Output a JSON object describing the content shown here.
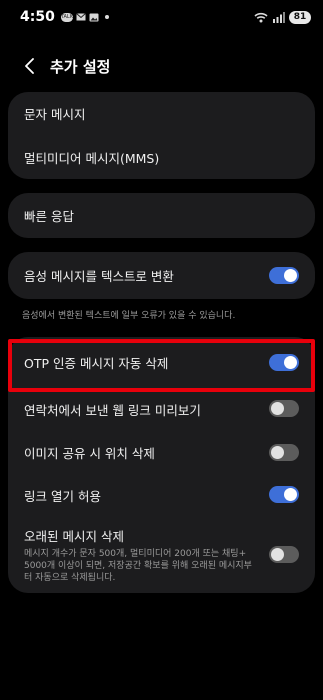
{
  "status_bar": {
    "time": "4:50",
    "icons": [
      "chat-icon",
      "mail-icon",
      "image-icon",
      "dot-icon",
      "wifi-icon",
      "signal-icon"
    ],
    "battery": "81"
  },
  "header": {
    "back_icon": "chevron-left-icon",
    "title": "추가 설정"
  },
  "group1": {
    "items": [
      {
        "label": "문자 메시지"
      },
      {
        "label": "멀티미디어 메시지(MMS)"
      }
    ]
  },
  "group2": {
    "items": [
      {
        "label": "빠른 응답"
      }
    ]
  },
  "group3": {
    "label": "음성 메시지를 텍스트로 변환",
    "enabled": true,
    "helper": "음성에서 변환된 텍스트에 일부 오류가 있을 수 있습니다."
  },
  "group4": {
    "items": [
      {
        "label": "OTP 인증 메시지 자동 삭제",
        "enabled": true
      },
      {
        "label": "연락처에서 보낸 웹 링크 미리보기",
        "enabled": false
      },
      {
        "label": "이미지 공유 시 위치 삭제",
        "enabled": false
      },
      {
        "label": "링크 열기 허용",
        "enabled": true
      },
      {
        "label": "오래된 메시지 삭제",
        "sub": "메시지 개수가 문자 500개, 멀티미디어 200개 또는 채팅+ 5000개 이상이 되면, 저장공간 확보를 위해 오래된 메시지부터 자동으로 삭제됩니다.",
        "enabled": false
      }
    ]
  },
  "colors": {
    "background": "#000000",
    "card": "#1c1c1e",
    "toggle_on": "#3e6fd8",
    "toggle_off": "#5c5c5c",
    "highlight": "#e8000b"
  }
}
